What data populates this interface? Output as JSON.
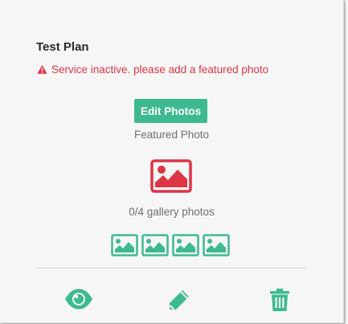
{
  "card": {
    "title": "Test Plan",
    "warning_icon": "exclamation-triangle-icon",
    "warning_text": "Service inactive. please add a featured photo",
    "edit_photos_label": "Edit Photos",
    "featured_photo_label": "Featured Photo",
    "featured_photo_icon": "image-icon",
    "gallery_label": "0/4 gallery photos",
    "gallery_slots": [
      {
        "icon": "image-icon"
      },
      {
        "icon": "image-icon"
      },
      {
        "icon": "image-icon"
      },
      {
        "icon": "image-icon"
      }
    ],
    "actions": [
      {
        "name": "view",
        "icon": "eye-icon"
      },
      {
        "name": "edit",
        "icon": "pencil-icon"
      },
      {
        "name": "delete",
        "icon": "trash-icon"
      }
    ]
  },
  "colors": {
    "accent": "#3dba91",
    "danger": "#dc3545",
    "muted_text": "#6f6f6f",
    "title_text": "#2b2b2b"
  }
}
